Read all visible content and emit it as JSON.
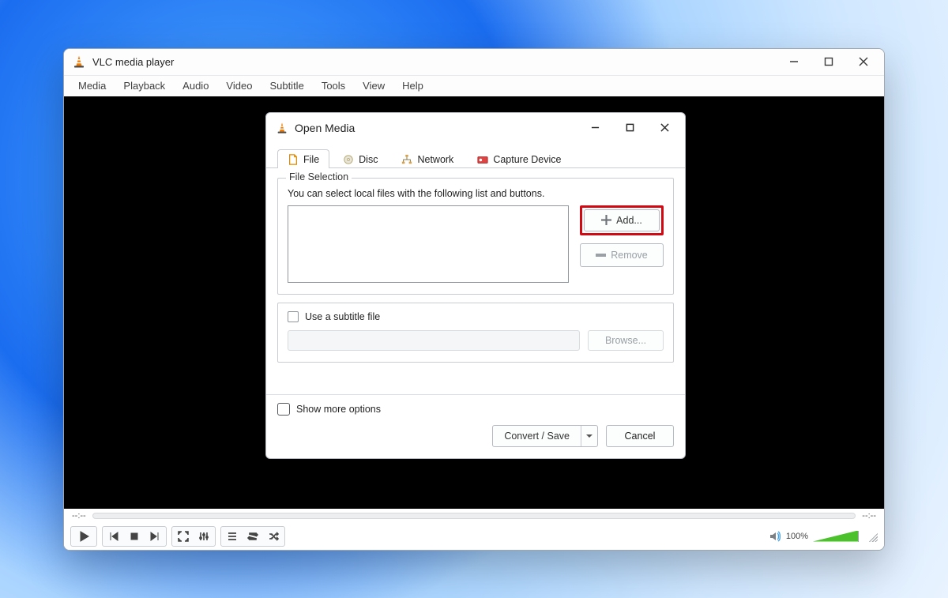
{
  "window": {
    "title": "VLC media player"
  },
  "menubar": [
    "Media",
    "Playback",
    "Audio",
    "Video",
    "Subtitle",
    "Tools",
    "View",
    "Help"
  ],
  "progress": {
    "left_time": "--:--",
    "right_time": "--:--"
  },
  "volume": {
    "percent_label": "100%"
  },
  "modal": {
    "title": "Open Media",
    "tabs": {
      "file": "File",
      "disc": "Disc",
      "network": "Network",
      "capture": "Capture Device"
    },
    "file_selection": {
      "group_title": "File Selection",
      "hint": "You can select local files with the following list and buttons.",
      "add_label": "Add...",
      "remove_label": "Remove"
    },
    "subtitle": {
      "checkbox_label": "Use a subtitle file",
      "browse_label": "Browse..."
    },
    "show_more_label": "Show more options",
    "convert_label": "Convert / Save",
    "cancel_label": "Cancel"
  }
}
